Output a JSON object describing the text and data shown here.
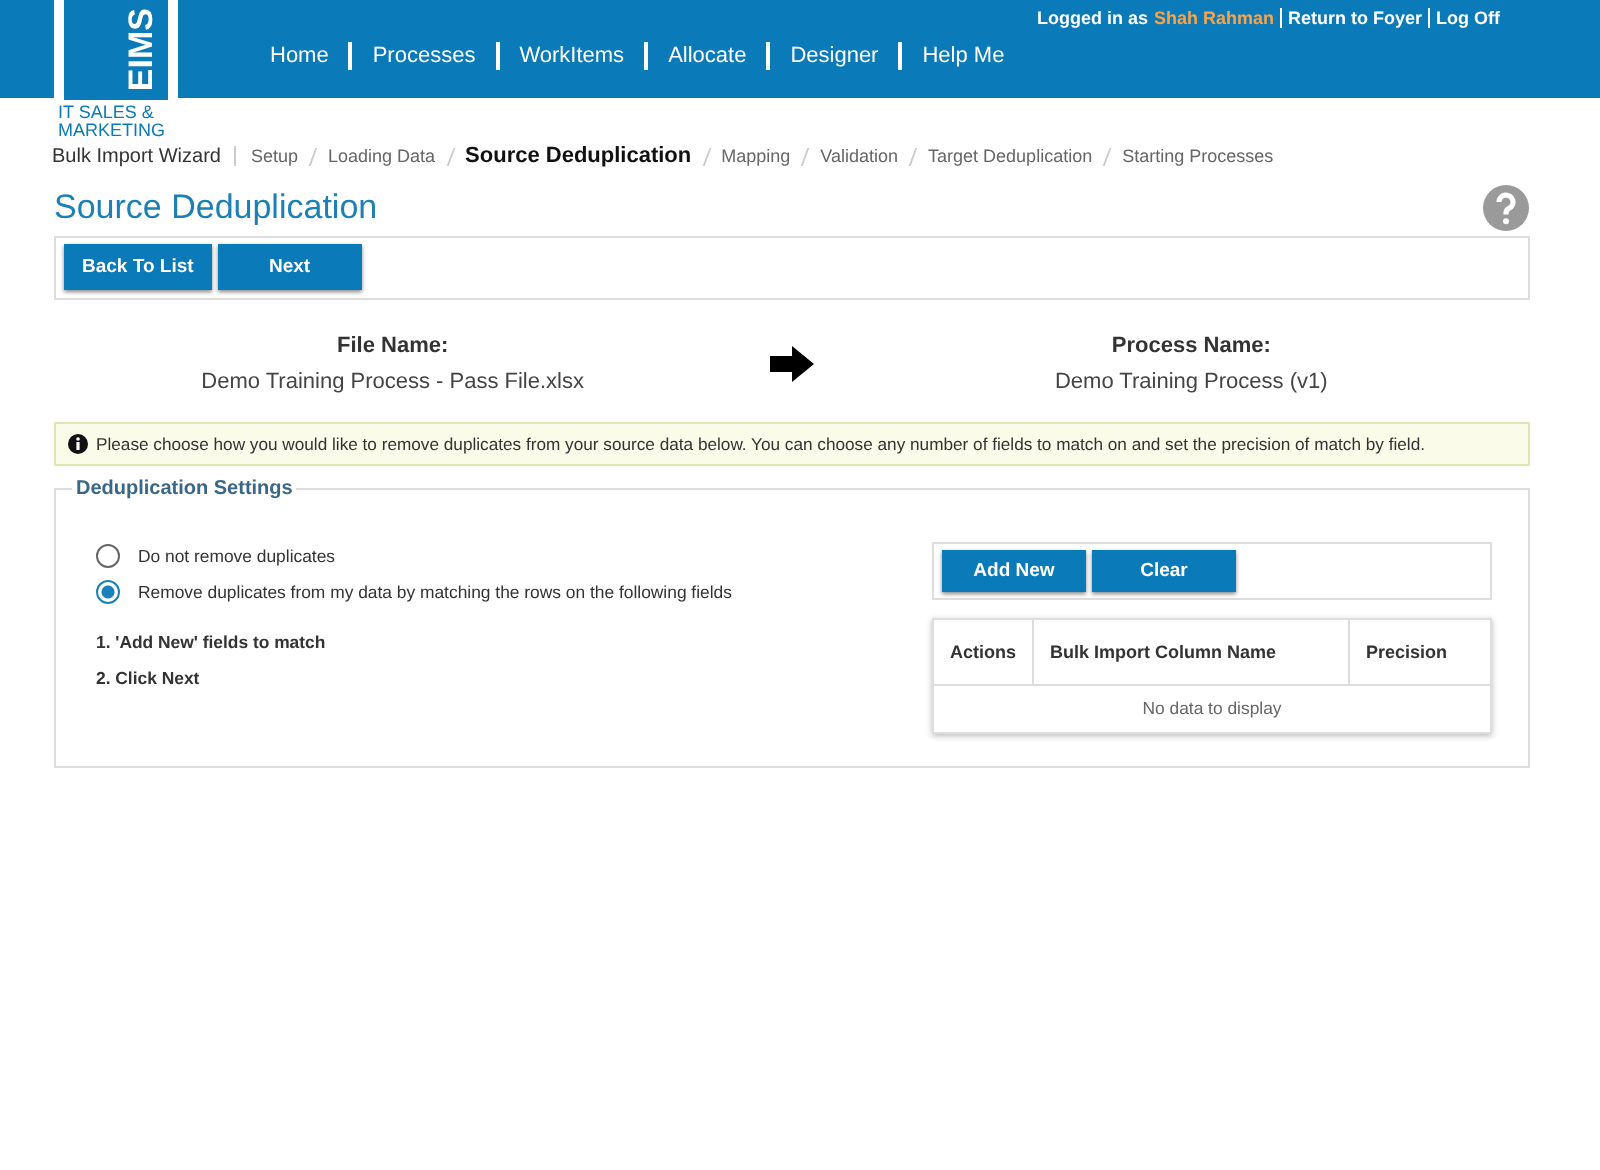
{
  "logo": {
    "mark": "EIMS",
    "caption": "IT SALES & MARKETING"
  },
  "nav": [
    {
      "label": "Home"
    },
    {
      "label": "Processes"
    },
    {
      "label": "WorkItems"
    },
    {
      "label": "Allocate"
    },
    {
      "label": "Designer"
    },
    {
      "label": "Help Me"
    }
  ],
  "user_bar": {
    "prefix": "Logged in as",
    "user": "Shah Rahman",
    "links": [
      "Return to Foyer",
      "Log Off"
    ]
  },
  "wizard": {
    "title": "Bulk Import Wizard",
    "steps": [
      {
        "label": "Setup",
        "selected": false
      },
      {
        "label": "Loading Data",
        "selected": false
      },
      {
        "label": "Source Deduplication",
        "selected": true
      },
      {
        "label": "Mapping",
        "selected": false
      },
      {
        "label": "Validation",
        "selected": false
      },
      {
        "label": "Target Deduplication",
        "selected": false
      },
      {
        "label": "Starting Processes",
        "selected": false
      }
    ]
  },
  "page_title": "Source Deduplication",
  "toolbar": [
    "Back To List",
    "Next"
  ],
  "file": {
    "label": "File Name:",
    "value": "Demo Training Process - Pass File.xlsx"
  },
  "process": {
    "label": "Process Name:",
    "value": "Demo Training Process (v1)"
  },
  "info": "Please choose how you would like to remove duplicates from your source data below. You can choose any number of fields to match on and set the precision of match by field.",
  "settings": {
    "legend": "Deduplication Settings",
    "options": [
      {
        "label": "Do not remove duplicates",
        "selected": false
      },
      {
        "label": "Remove duplicates from my data by matching the rows on the following fields",
        "selected": true
      }
    ],
    "steps": [
      "1. 'Add New' fields to match",
      "2. Click Next"
    ],
    "buttons": [
      "Add New",
      "Clear"
    ],
    "table": {
      "columns": [
        "Actions",
        "Bulk Import Column Name",
        "Precision"
      ],
      "empty": "No data to display"
    }
  }
}
